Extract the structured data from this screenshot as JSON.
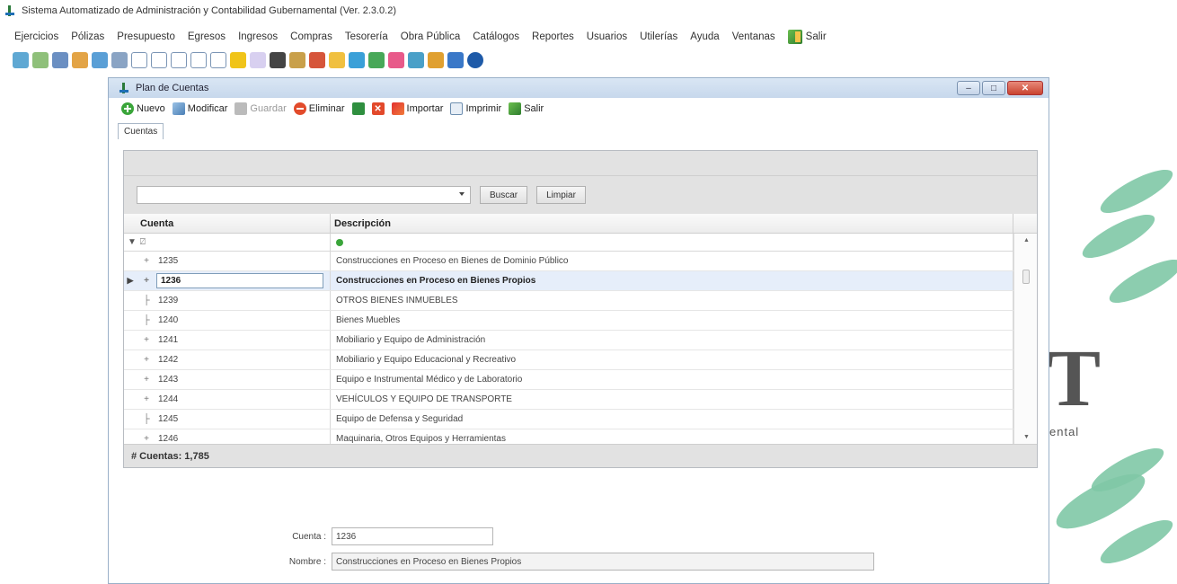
{
  "app": {
    "title": "Sistema Automatizado de Administración y Contabilidad Gubernamental  (Ver. 2.3.0.2)"
  },
  "menu": {
    "items": [
      "Ejercicios",
      "Pólizas",
      "Presupuesto",
      "Egresos",
      "Ingresos",
      "Compras",
      "Tesorería",
      "Obra Pública",
      "Catálogos",
      "Reportes",
      "Usuarios",
      "Utilerías",
      "Ayuda",
      "Ventanas"
    ],
    "exit": "Salir"
  },
  "watermark": {
    "letter": "T",
    "text": "ental"
  },
  "window": {
    "title": "Plan de Cuentas",
    "toolbar": {
      "nuevo": "Nuevo",
      "modificar": "Modificar",
      "guardar": "Guardar",
      "eliminar": "Eliminar",
      "importar": "Importar",
      "imprimir": "Imprimir",
      "salir": "Salir"
    },
    "tab": "Cuentas",
    "search": {
      "buscar": "Buscar",
      "limpiar": "Limpiar"
    },
    "grid": {
      "headers": [
        "Cuenta",
        "Descripción"
      ],
      "rows": [
        {
          "cuenta": "1235",
          "descripcion": "Construcciones en Proceso en Bienes de Dominio Público",
          "tree": "+",
          "indicator": ""
        },
        {
          "cuenta": "1236",
          "descripcion": "Construcciones en Proceso en Bienes Propios",
          "tree": "+",
          "indicator": "▶"
        },
        {
          "cuenta": "1239",
          "descripcion": "OTROS BIENES INMUEBLES",
          "tree": "├",
          "indicator": ""
        },
        {
          "cuenta": "1240",
          "descripcion": "Bienes Muebles",
          "tree": "├",
          "indicator": ""
        },
        {
          "cuenta": "1241",
          "descripcion": "Mobiliario y Equipo de Administración",
          "tree": "+",
          "indicator": ""
        },
        {
          "cuenta": "1242",
          "descripcion": "Mobiliario y Equipo Educacional y Recreativo",
          "tree": "+",
          "indicator": ""
        },
        {
          "cuenta": "1243",
          "descripcion": "Equipo e Instrumental Médico y de Laboratorio",
          "tree": "+",
          "indicator": ""
        },
        {
          "cuenta": "1244",
          "descripcion": "VEHÍCULOS Y EQUIPO DE TRANSPORTE",
          "tree": "+",
          "indicator": ""
        },
        {
          "cuenta": "1245",
          "descripcion": "Equipo de Defensa y Seguridad",
          "tree": "├",
          "indicator": ""
        },
        {
          "cuenta": "1246",
          "descripcion": "Maquinaria, Otros Equipos y Herramientas",
          "tree": "+",
          "indicator": ""
        }
      ],
      "count_label": "# Cuentas: 1,785"
    },
    "form": {
      "cuenta_label": "Cuenta :",
      "cuenta_value": "1236",
      "nombre_label": "Nombre :",
      "nombre_value": "Construcciones en Proceso en Bienes Propios"
    }
  },
  "colors": {
    "accent_green": "#3aa53a",
    "selected_row": "#e6eefa",
    "title_bar": "#c7d8ec"
  }
}
